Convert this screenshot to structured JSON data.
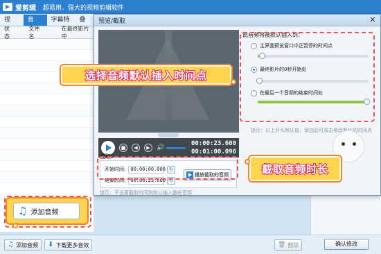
{
  "app": {
    "name": "爱剪辑",
    "slogan": "超易用、强大的视频剪辑软件"
  },
  "menu": {
    "tabs": [
      "视　频",
      "音　频",
      "字幕特效",
      "叠加"
    ]
  },
  "audio_list": {
    "columns": [
      "状态",
      "文件名",
      "在最终影片中"
    ]
  },
  "bottom_bar": {
    "add_audio_label": "添加音频",
    "download_more_label": "下载更多音效",
    "delete_label": "删除",
    "confirm_label": "确认修改"
  },
  "dialog": {
    "title": "预览/截取",
    "close_glyph": "✕",
    "time_current": "00:00:23.600",
    "time_total": "00:01:00.096",
    "trim": {
      "section_label": "截取:",
      "start_label": "开始时间:",
      "start_value": "00:00:00.000",
      "end_label": "结束时间:",
      "end_value": "00:00:23.600",
      "play_button_label": "播放截取的音频",
      "tip": "提示：不设置截取时间则默认插入整段音频"
    },
    "insert": {
      "heading": "此音频将被默认插入到：",
      "options": [
        "主界面预览窗口中正暂停的时间点",
        "最终影片的0秒开始处",
        "在最后一个音频的结束时间处"
      ],
      "selected_index": 1,
      "tip": "提示：以上开头默认值，添加后可双击修改影片的时间点"
    }
  },
  "annotations": {
    "callout_insert": "选择音频默认插入时间点",
    "callout_trim": "截取音频时长",
    "add_audio_button": "添加音频"
  },
  "colors": {
    "titlebar": "#2d7fd0",
    "callout_fill": "#ffd54f",
    "callout_border": "#f58220",
    "callout_text_stroke": "#e91e63",
    "highlight_dash": "#ef5350"
  }
}
